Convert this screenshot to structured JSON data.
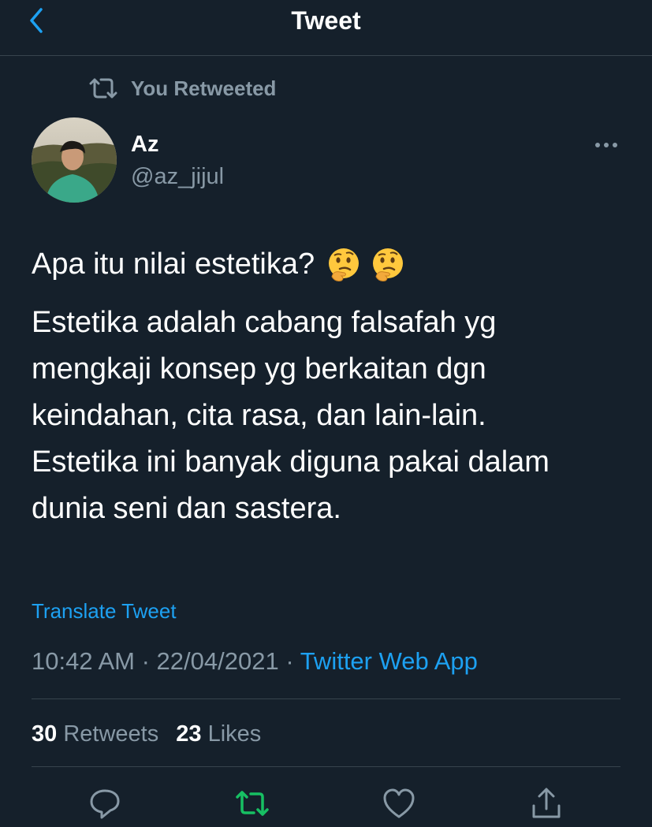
{
  "header": {
    "title": "Tweet",
    "back_icon": "chevron-left-icon"
  },
  "retweet_context": {
    "icon": "retweet-icon",
    "label": "You Retweeted"
  },
  "author": {
    "name": "Az",
    "handle": "@az_jijul"
  },
  "tweet": {
    "line1": "Apa itu nilai estetika?",
    "emojis": [
      "thinking-face-emoji",
      "thinking-face-emoji"
    ],
    "para_lines": [
      "Estetika adalah cabang falsafah yg",
      "mengkaji konsep yg berkaitan dgn",
      "keindahan, cita rasa, dan lain-lain.",
      "Estetika ini banyak diguna pakai dalam",
      "dunia seni dan sastera."
    ]
  },
  "translate_label": "Translate Tweet",
  "meta": {
    "time": "10:42 AM",
    "separator": " · ",
    "date": "22/04/2021",
    "source": "Twitter Web App"
  },
  "stats": {
    "retweets_count": "30",
    "retweets_label": "Retweets",
    "likes_count": "23",
    "likes_label": "Likes"
  },
  "actions": [
    "reply-icon",
    "retweet-icon",
    "like-icon",
    "share-icon"
  ],
  "colors": {
    "background": "#15202b",
    "accent": "#1da1f2",
    "secondary_text": "#8899a6",
    "retweet_active": "#17bf63",
    "divider": "#38444d"
  }
}
